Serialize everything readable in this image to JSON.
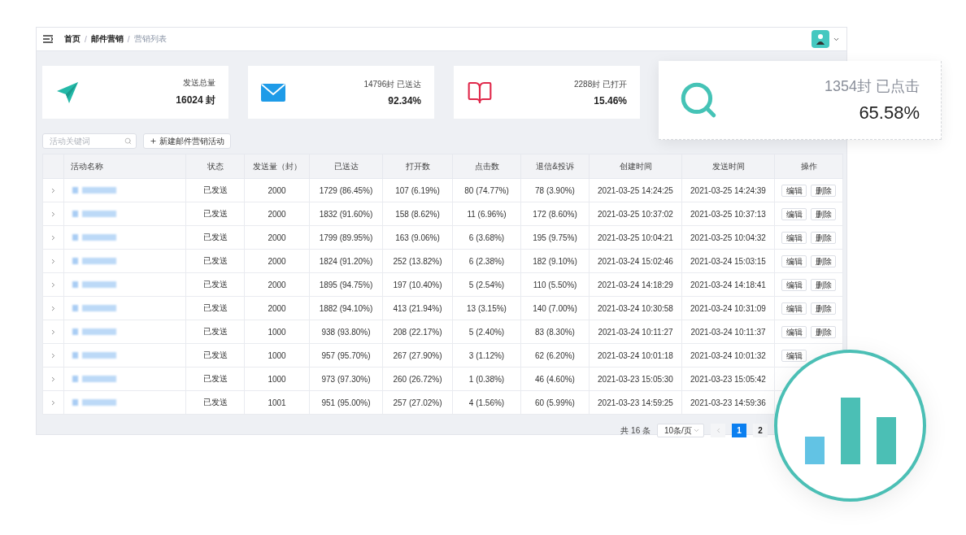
{
  "breadcrumb": {
    "separators": [
      "/",
      "/"
    ],
    "items": [
      {
        "label": "首页",
        "current": false
      },
      {
        "label": "邮件营销",
        "current": false
      },
      {
        "label": "营销列表",
        "current": true
      }
    ]
  },
  "stats": [
    {
      "kind": "plane",
      "label": "发送总量",
      "value": "16024 封"
    },
    {
      "kind": "mail",
      "label": "14796封 已送达",
      "value": "92.34%"
    },
    {
      "kind": "book",
      "label": "2288封 已打开",
      "value": "15.46%"
    }
  ],
  "highlight_card": {
    "label": "1354封 已点击",
    "value": "65.58%"
  },
  "search": {
    "placeholder": "活动关键词"
  },
  "new_button": "新建邮件营销活动",
  "table": {
    "columns": [
      "",
      "活动名称",
      "状态",
      "发送量（封）",
      "已送达",
      "打开数",
      "点击数",
      "退信&投诉",
      "创建时间",
      "发送时间",
      "操作"
    ],
    "rows": [
      {
        "expanded": false,
        "cells": [
          "",
          "",
          "已发送",
          "2000",
          "1729 (86.45%)",
          "107 (6.19%)",
          "80 (74.77%)",
          "78 (3.90%)",
          "2021-03-25 14:24:25",
          "2021-03-25 14:24:39"
        ],
        "actions": [
          "编辑",
          "删除"
        ]
      },
      {
        "expanded": false,
        "cells": [
          "",
          "",
          "已发送",
          "2000",
          "1832 (91.60%)",
          "158 (8.62%)",
          "11 (6.96%)",
          "172 (8.60%)",
          "2021-03-25 10:37:02",
          "2021-03-25 10:37:13"
        ],
        "actions": [
          "编辑",
          "删除"
        ]
      },
      {
        "expanded": false,
        "cells": [
          "",
          "",
          "已发送",
          "2000",
          "1799 (89.95%)",
          "163 (9.06%)",
          "6 (3.68%)",
          "195 (9.75%)",
          "2021-03-25 10:04:21",
          "2021-03-25 10:04:32"
        ],
        "actions": [
          "编辑",
          "删除"
        ]
      },
      {
        "expanded": false,
        "cells": [
          "",
          "",
          "已发送",
          "2000",
          "1824 (91.20%)",
          "252 (13.82%)",
          "6 (2.38%)",
          "182 (9.10%)",
          "2021-03-24 15:02:46",
          "2021-03-24 15:03:15"
        ],
        "actions": [
          "编辑",
          "删除"
        ]
      },
      {
        "expanded": false,
        "cells": [
          "",
          "",
          "已发送",
          "2000",
          "1895 (94.75%)",
          "197 (10.40%)",
          "5 (2.54%)",
          "110 (5.50%)",
          "2021-03-24 14:18:29",
          "2021-03-24 14:18:41"
        ],
        "actions": [
          "编辑",
          "删除"
        ]
      },
      {
        "expanded": false,
        "cells": [
          "",
          "",
          "已发送",
          "2000",
          "1882 (94.10%)",
          "413 (21.94%)",
          "13 (3.15%)",
          "140 (7.00%)",
          "2021-03-24 10:30:58",
          "2021-03-24 10:31:09"
        ],
        "actions": [
          "编辑",
          "删除"
        ]
      },
      {
        "expanded": false,
        "cells": [
          "",
          "",
          "已发送",
          "1000",
          "938 (93.80%)",
          "208 (22.17%)",
          "5 (2.40%)",
          "83 (8.30%)",
          "2021-03-24 10:11:27",
          "2021-03-24 10:11:37"
        ],
        "actions": [
          "编辑",
          "删除"
        ]
      },
      {
        "expanded": false,
        "cells": [
          "",
          "",
          "已发送",
          "1000",
          "957 (95.70%)",
          "267 (27.90%)",
          "3 (1.12%)",
          "62 (6.20%)",
          "2021-03-24 10:01:18",
          "2021-03-24 10:01:32"
        ],
        "actions": [
          "编辑"
        ]
      },
      {
        "expanded": false,
        "cells": [
          "",
          "",
          "已发送",
          "1000",
          "973 (97.30%)",
          "260 (26.72%)",
          "1 (0.38%)",
          "46 (4.60%)",
          "2021-03-23 15:05:30",
          "2021-03-23 15:05:42"
        ],
        "actions": []
      },
      {
        "expanded": false,
        "cells": [
          "",
          "",
          "已发送",
          "1001",
          "951 (95.00%)",
          "257 (27.02%)",
          "4 (1.56%)",
          "60 (5.99%)",
          "2021-03-23 14:59:25",
          "2021-03-23 14:59:36"
        ],
        "actions": []
      }
    ]
  },
  "pagination": {
    "total": "共 16 条",
    "page_size": "10条/页",
    "pages": [
      {
        "label": "1",
        "selected": true
      },
      {
        "label": "2",
        "selected": false
      }
    ]
  }
}
